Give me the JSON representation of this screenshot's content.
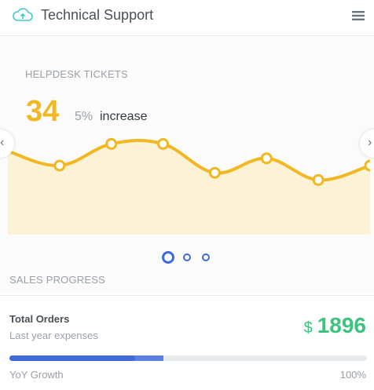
{
  "header": {
    "title": "Technical Support",
    "cloud_icon": "cloud-upload-icon",
    "menu_icon": "hamburger-menu-icon"
  },
  "widget": {
    "subheading": "HELPDESK TICKETS",
    "number": "34",
    "percent": "5%",
    "percent_label": "increase"
  },
  "carousel": {
    "prev_icon": "chevron-left-icon",
    "next_icon": "chevron-right-icon",
    "prev_glyph": "‹",
    "next_glyph": "›",
    "slides": 3,
    "active_slide": 1
  },
  "section": {
    "label": "SALES PROGRESS"
  },
  "orders": {
    "title": "Total Orders",
    "subtitle": "Last year expenses",
    "currency": "$",
    "amount": "1896",
    "progress_label": "YoY Growth",
    "progress_value_label": "100%",
    "progress_fraction": 0.43
  },
  "colors": {
    "accent_yellow": "#f1b823",
    "area_fill": "#fcf2d5",
    "success_green": "#3ac47d",
    "primary_blue": "#3f6ad8"
  },
  "chart_data": {
    "type": "area",
    "points": [
      2,
      0,
      3,
      3,
      -1,
      1,
      -2,
      0
    ],
    "marked_points": [
      1,
      2,
      3,
      4,
      5,
      6,
      7
    ],
    "ylim": [
      -5,
      5
    ]
  }
}
